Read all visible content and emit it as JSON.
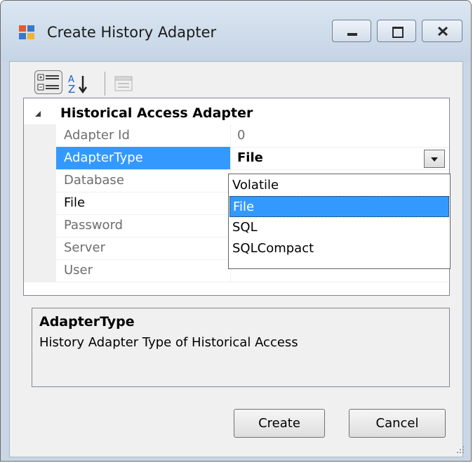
{
  "window": {
    "title": "Create History Adapter"
  },
  "toolbar": {
    "categorized_icon": "categorized-view-icon",
    "alphabetical_icon": "sort-alphabetical-icon",
    "property_pages_icon": "property-pages-icon"
  },
  "grid": {
    "category": "Historical Access Adapter",
    "properties": [
      {
        "name": "Adapter Id",
        "value": "0"
      },
      {
        "name": "AdapterType",
        "value": "File"
      },
      {
        "name": "Database",
        "value": ""
      },
      {
        "name": "File",
        "value": ""
      },
      {
        "name": "Password",
        "value": ""
      },
      {
        "name": "Server",
        "value": ""
      },
      {
        "name": "User",
        "value": ""
      }
    ],
    "dropdown_options": [
      "Volatile",
      "File",
      "SQL",
      "SQLCompact"
    ],
    "dropdown_selected": "File"
  },
  "description": {
    "title": "AdapterType",
    "text": "History Adapter Type of Historical Access"
  },
  "buttons": {
    "create": "Create",
    "cancel": "Cancel"
  },
  "colors": {
    "selection": "#3399ff",
    "window_frame": "#c8d6e6"
  }
}
